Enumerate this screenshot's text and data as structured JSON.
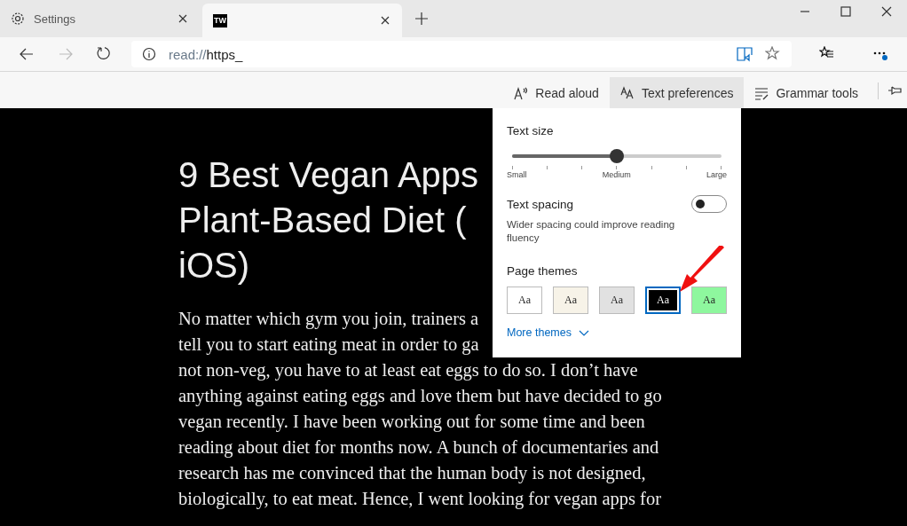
{
  "tabs": [
    {
      "title": "Settings",
      "selected": false
    },
    {
      "logo_text": "TW",
      "selected": true
    }
  ],
  "address": {
    "url_scheme": "read://",
    "url_rest": "https_"
  },
  "reader_toolbar": [
    {
      "label": "Read aloud",
      "selected": false
    },
    {
      "label": "Text preferences",
      "selected": true
    },
    {
      "label": "Grammar tools",
      "selected": false
    }
  ],
  "article": {
    "title_lines": [
      "9 Best Vegan Apps",
      "Plant-Based Diet (",
      "iOS)"
    ],
    "body_lines": [
      "No matter which gym you join, trainers a",
      "tell you to start eating meat in order to ga",
      "not non-veg, you have to at least eat eggs to do so. I don’t have",
      "anything against eating eggs and love them but have decided to go",
      "vegan recently. I have been working out for some time and been",
      "reading about diet for months now. A bunch of documentaries and",
      "research has me convinced that the human body is not designed,",
      "biologically, to eat meat. Hence, I went looking for vegan apps for"
    ]
  },
  "text_preferences": {
    "text_size": {
      "label": "Text size",
      "level": 0.5,
      "scale": [
        "Small",
        "Medium",
        "Large"
      ]
    },
    "text_spacing": {
      "label": "Text spacing",
      "on": false,
      "description": "Wider spacing could improve reading fluency"
    },
    "page_themes": {
      "label": "Page themes",
      "themes": [
        {
          "sample": "Aa",
          "color": "#ffffff",
          "selected": false
        },
        {
          "sample": "Aa",
          "color": "#f7f3e8",
          "selected": false
        },
        {
          "sample": "Aa",
          "color": "#e1e1e1",
          "selected": false
        },
        {
          "sample": "Aa",
          "color": "#000000",
          "selected": true
        },
        {
          "sample": "Aa",
          "color": "#8ef79e",
          "selected": false
        }
      ],
      "more": "More themes"
    }
  }
}
